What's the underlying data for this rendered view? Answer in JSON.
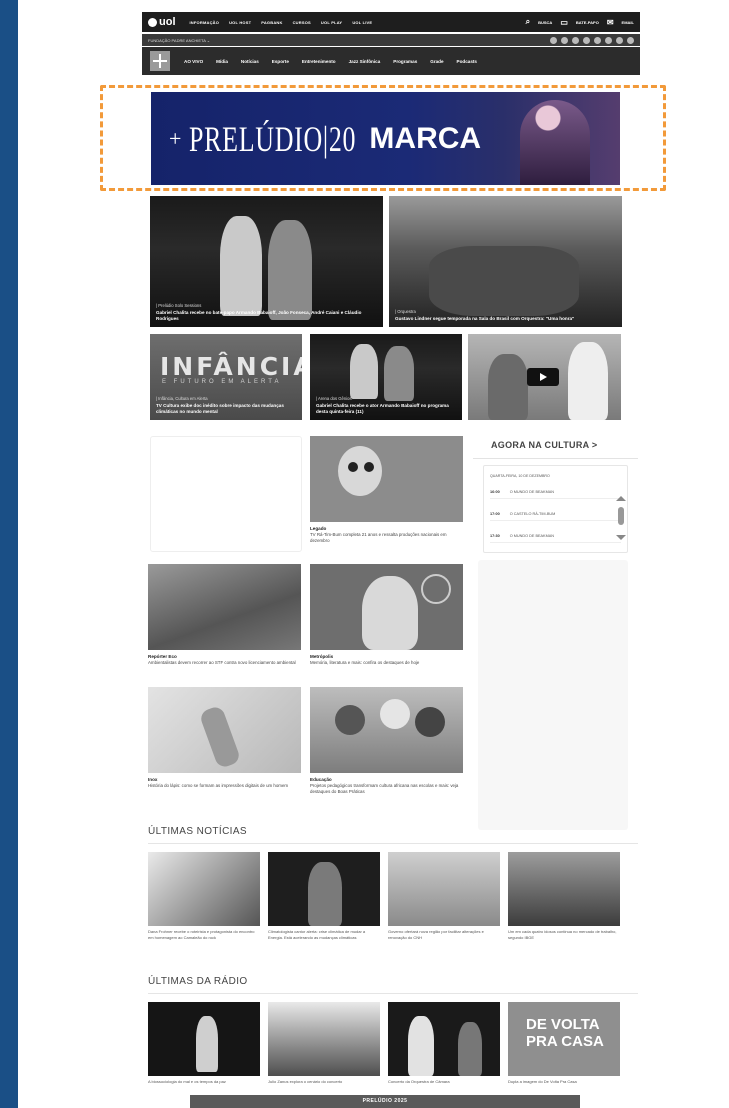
{
  "topbar": {
    "logo": "uol",
    "links": [
      "INFORMAÇÃO",
      "UOL HOST",
      "PAGBANK",
      "CURSOS",
      "UOL PLAY",
      "UOL LIVE"
    ],
    "search": "BUSCA",
    "login": "BATE-PAPO",
    "email": "EMAIL"
  },
  "subbar": {
    "label": "FUNDAÇÃO PADRE ANCHIETA ⌄"
  },
  "nav": {
    "items": [
      "AO VIVO",
      "Mídia",
      "Notícias",
      "Esporte",
      "Entretenimento",
      "Jazz Sinfônica",
      "Programas",
      "Grade",
      "Podcasts"
    ]
  },
  "banner": {
    "plus": "+",
    "title": "PRELÚDIO|20",
    "brand": "MARCA"
  },
  "hero": [
    {
      "kicker": "| Prelúdio Solo Sessions",
      "title": "Gabriel Chalita recebe no bate-papo Armando Babaioff, João Fonseca, André Caiani e Cláudio Rodrigues"
    },
    {
      "kicker": "| Orquestra",
      "title": "Gustavo Lindner segue temporada na Sala do Brasil com Orquestra: \"Uma honra\""
    }
  ],
  "row2": [
    {
      "overlay": "INFÂNCIA",
      "overlay_sub": "E FUTURO EM ALERTA",
      "kicker": "| Infância, Cultura em Alerta",
      "title": "TV Cultura exibe doc inédito sobre impacto das mudanças climáticas no mundo mental"
    },
    {
      "kicker": "| Arena dos Gênios",
      "title": "Gabriel Chalita recebe o ator Armando Babaioff no programa desta quinta-feira (11)"
    }
  ],
  "legado": {
    "kicker": "Legado",
    "text": "TV Rá-Tim-Bum completa 21 anos e ressalta produções nacionais em dezembro"
  },
  "agora": {
    "title": "AGORA NA CULTURA >",
    "date": "QUARTA-FEIRA, 10 DE DEZEMBRO",
    "rows": [
      {
        "time": "16:00",
        "show": "O MUNDO DE BEAKMAN"
      },
      {
        "time": "17:00",
        "show": "O CASTELO RÁ-TIM-BUM"
      },
      {
        "time": "17:30",
        "show": "O MUNDO DE BEAKMAN"
      }
    ]
  },
  "cards": [
    {
      "kicker": "Repórter Eco",
      "text": "Ambientalistas devem recorrer ao STF contra novo licenciamento ambiental"
    },
    {
      "kicker": "Metrópolis",
      "text": "Memória, literatura e mais: confira os destaques de hoje"
    },
    {
      "kicker": "Inox",
      "text": "História do lápis: como se formam as impressões digitais de um homem"
    },
    {
      "kicker": "Educação",
      "text": "Projetos pedagógicos transformam cultura africana nas escolas e mais: veja destaques do Boas Práticas"
    }
  ],
  "ultimas": {
    "title": "ÚLTIMAS NOTÍCIAS",
    "items": [
      "Dana Frohner recebe o roteirista e protagonista do encontro em homenagem ao Camaleão do rock",
      "Climatologista cantor alerta: crise climática de mudar a Energia. Está acelerando as mudanças climáticas",
      "Governo ofertará nova região por facilitar alterações e renovação do CNH",
      "Um em cada quatro idosos continua no mercado de trabalho, segundo IBGE"
    ]
  },
  "radio": {
    "title": "ÚLTIMAS DA RÁDIO",
    "items": [
      "A biossociologia do mal e os tempos da paz",
      "Julio Zanus explora o cenário do concerto",
      "Concerto da Orquestra de Câmara",
      "Dupla a imagem do De Volta Pra Casa"
    ],
    "promo_line1": "DE VOLTA",
    "promo_line2": "PRA CASA"
  },
  "bottom": "PRELÚDIO 2025"
}
